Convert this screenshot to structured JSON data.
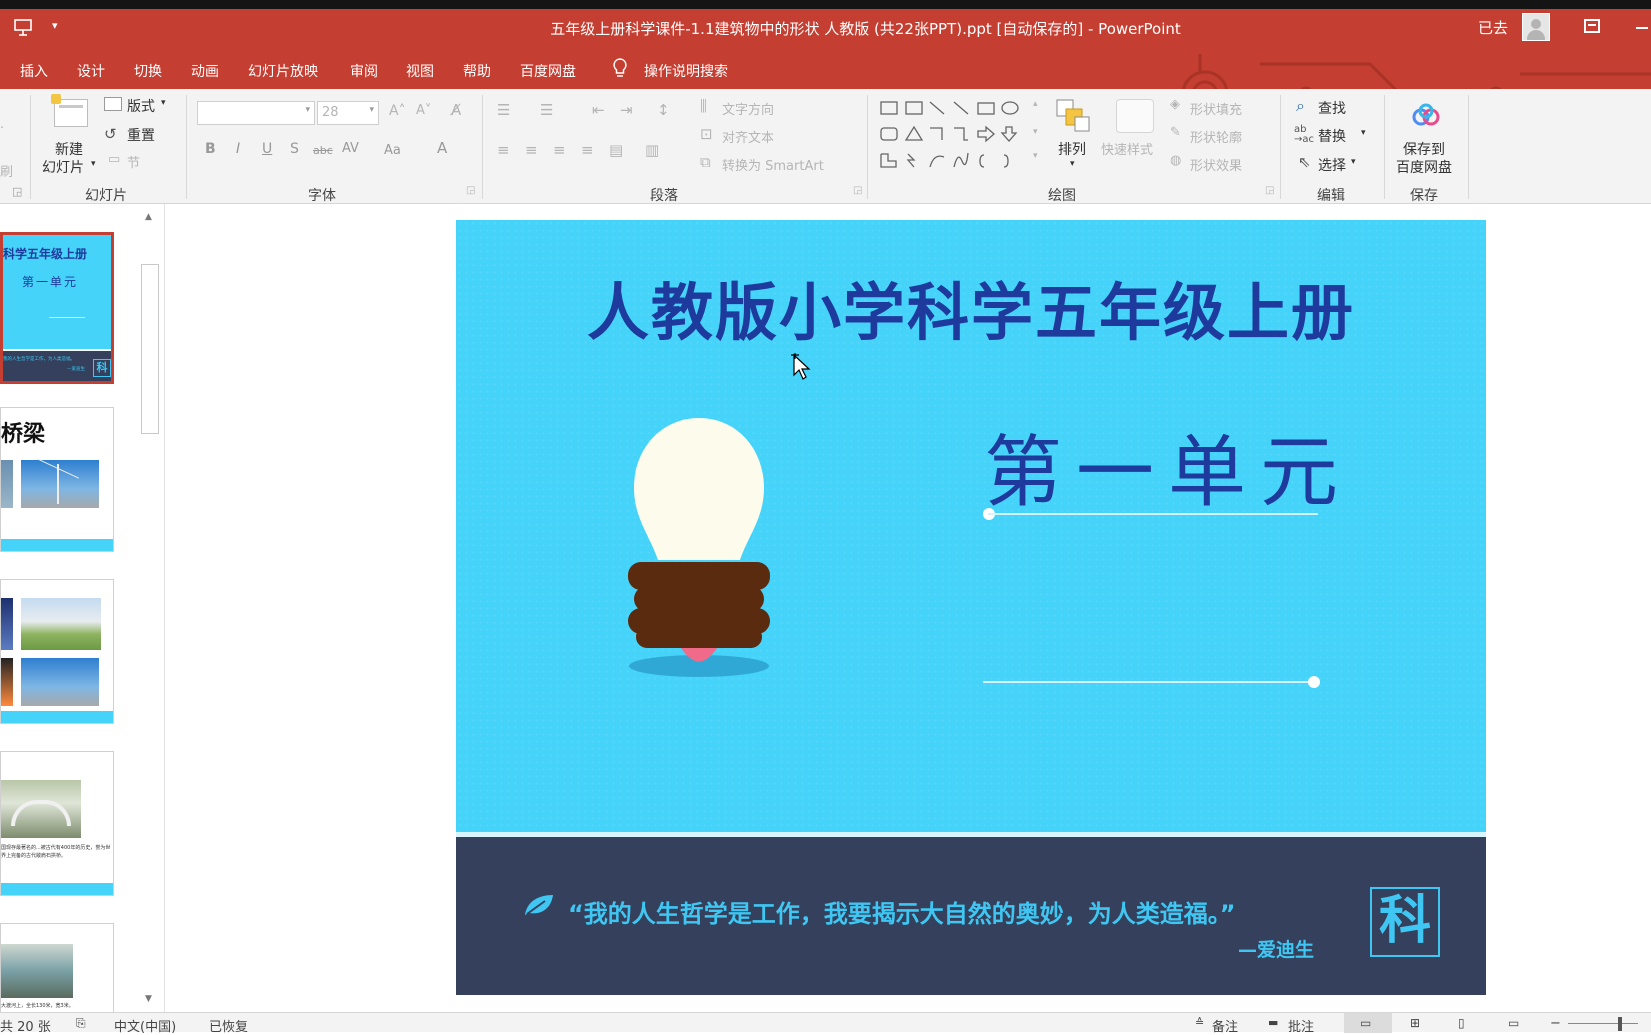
{
  "window": {
    "title": "五年级上册科学课件-1.1建筑物中的形状  人教版 (共22张PPT).ppt [自动保存的]  -  PowerPoint",
    "user": "已去"
  },
  "tabs": [
    "插入",
    "设计",
    "切换",
    "动画",
    "幻灯片放映",
    "审阅",
    "视图",
    "帮助",
    "百度网盘"
  ],
  "tell_me": "操作说明搜索",
  "ribbon": {
    "slides_group": {
      "label": "幻灯片",
      "new_slide_line1": "新建",
      "new_slide_line2": "幻灯片",
      "layout": "版式",
      "reset": "重置",
      "section": "节"
    },
    "font_group": {
      "label": "字体",
      "font_size": "28",
      "bold": "B",
      "italic": "I",
      "underline": "U",
      "shadow": "S",
      "strike": "abc",
      "spacing": "AV",
      "case": "Aa",
      "color": "A"
    },
    "paragraph_group": {
      "label": "段落",
      "text_direction": "文字方向",
      "align_text": "对齐文本",
      "smartart": "转换为 SmartArt"
    },
    "drawing_group": {
      "label": "绘图",
      "arrange": "排列",
      "quick_styles": "快速样式",
      "shape_fill": "形状填充",
      "shape_outline": "形状轮廓",
      "shape_effects": "形状效果"
    },
    "editing_group": {
      "label": "编辑",
      "find": "查找",
      "replace": "替换",
      "select": "选择"
    },
    "save_group": {
      "label": "保存",
      "save_line1": "保存到",
      "save_line2": "百度网盘"
    }
  },
  "thumbnails": {
    "t1_title": "科学五年级上册",
    "t1_sub": "第一单元",
    "t1_quote": "我的人生哲学是工作，为人类造福。",
    "t1_author": "—爱迪生",
    "t1_badge": "科",
    "t2_title": "桥梁",
    "t4_text": "国现存最著名的...被古代有400年的历史，誉为世界上完备的古代敞肩石拱桥。",
    "t5_text": "大渡河上，全长130米，宽3米。"
  },
  "slide": {
    "title": "人教版小学科学五年级上册",
    "unit": "第一单元",
    "quote": "“我的人生哲学是工作，我要揭示大自然的奥妙，为人类造福。”",
    "author": "—爱迪生",
    "badge": "科",
    "colors": {
      "background": "#45d3fa",
      "title": "#1e3a9c",
      "footer": "#34405c",
      "accent": "#3fc6f2"
    }
  },
  "status": {
    "slide_count": "共 20 张",
    "language": "中文(中国)",
    "recovered": "已恢复",
    "notes": "备注",
    "comments": "批注"
  },
  "colors": {
    "title_bar": "#c43e31",
    "ribbon": "#f3f3f3"
  }
}
